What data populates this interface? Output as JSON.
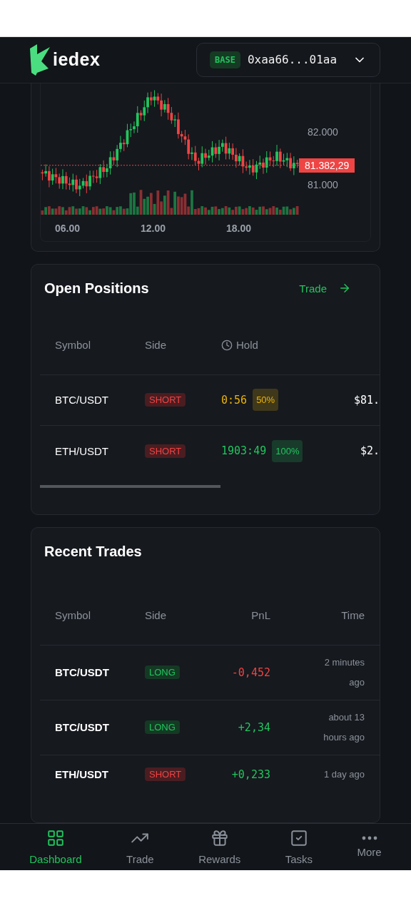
{
  "header": {
    "brand": "iedex",
    "wallet": {
      "network": "BASE",
      "address": "0xaa66...01aa"
    }
  },
  "price_chart": {
    "y_ticks": [
      "82.000",
      "81.000"
    ],
    "last_price": "81.382,29",
    "x_ticks": [
      "06.00",
      "12.00",
      "18.00"
    ]
  },
  "open_positions": {
    "title": "Open Positions",
    "link": "Trade",
    "columns": [
      "Symbol",
      "Side",
      "Hold"
    ],
    "rows": [
      {
        "symbol": "BTC/USDT",
        "side": {
          "label": "SHORT",
          "kind": "short"
        },
        "hold": {
          "time": "0:56",
          "share": "50%",
          "color": "#eab308"
        },
        "column_4": "$81."
      },
      {
        "symbol": "ETH/USDT",
        "side": {
          "label": "SHORT",
          "kind": "short"
        },
        "hold": {
          "time": "1903:49",
          "share": "100%",
          "color": "#22c55e"
        },
        "column_4": "$2."
      }
    ]
  },
  "recent_trades": {
    "title": "Recent Trades",
    "columns": [
      "Symbol",
      "Side",
      "PnL",
      "Time"
    ],
    "rows": [
      {
        "symbol": "BTC/USDT",
        "side": {
          "label": "LONG",
          "kind": "long"
        },
        "pnl": {
          "value": "-0,452",
          "color": "#ef4444"
        },
        "time": "2 minutes ago"
      },
      {
        "symbol": "BTC/USDT",
        "side": {
          "label": "LONG",
          "kind": "long"
        },
        "pnl": {
          "value": "+2,34",
          "color": "#22c55e"
        },
        "time": "about 13 hours ago"
      },
      {
        "symbol": "ETH/USDT",
        "side": {
          "label": "SHORT",
          "kind": "short"
        },
        "pnl": {
          "value": "+0,233",
          "color": "#22c55e"
        },
        "time": "1 day ago"
      }
    ]
  },
  "bottom_nav": [
    {
      "label": "Dashboard",
      "selected": true
    },
    {
      "label": "Trade",
      "selected": false
    },
    {
      "label": "Rewards",
      "selected": false
    },
    {
      "label": "Tasks",
      "selected": false
    },
    {
      "label": "More",
      "selected": false
    }
  ]
}
